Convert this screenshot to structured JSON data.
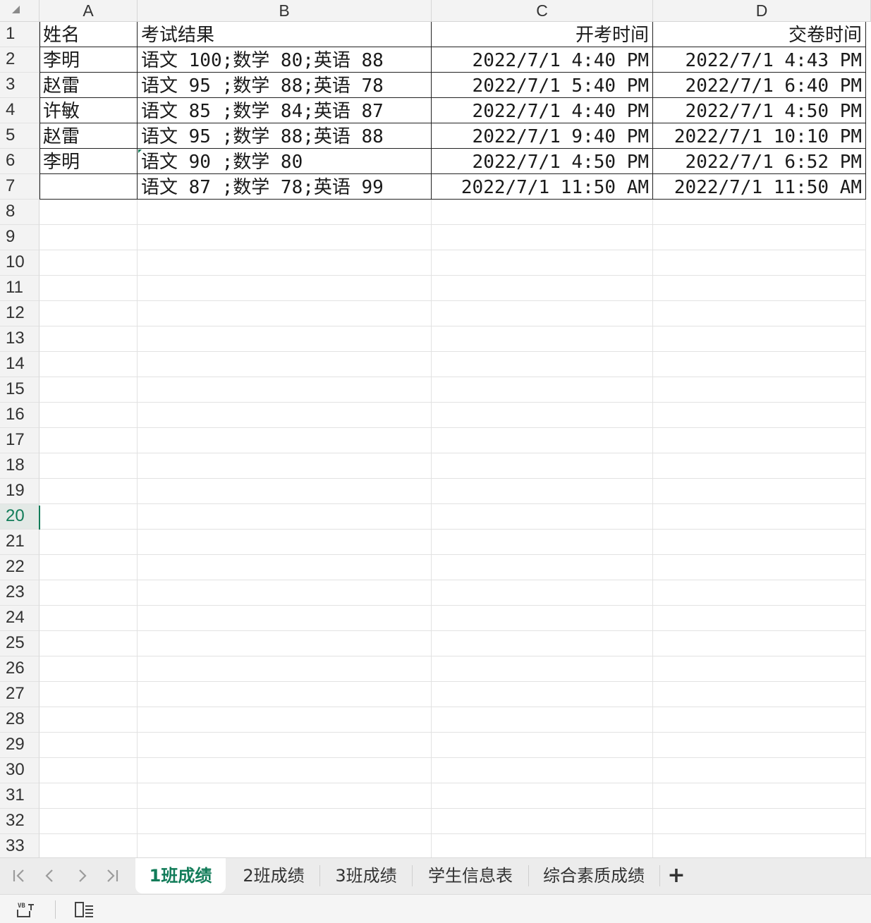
{
  "columns": [
    "A",
    "B",
    "C",
    "D"
  ],
  "rows": [
    {
      "num": "1",
      "cells": [
        "姓名",
        "考试结果",
        "开考时间",
        "交卷时间"
      ]
    },
    {
      "num": "2",
      "cells": [
        "李明",
        "语文 100;数学 80;英语 88",
        "2022/7/1 4:40 PM",
        "2022/7/1 4:43 PM"
      ]
    },
    {
      "num": "3",
      "cells": [
        "赵雷",
        "语文 95 ;数学 88;英语 78",
        "2022/7/1 5:40 PM",
        "2022/7/1 6:40 PM"
      ]
    },
    {
      "num": "4",
      "cells": [
        "许敏",
        "语文 85 ;数学 84;英语 87",
        "2022/7/1 4:40 PM",
        "2022/7/1 4:50 PM"
      ]
    },
    {
      "num": "5",
      "cells": [
        "赵雷",
        "语文 95 ;数学 88;英语 88",
        "2022/7/1 9:40 PM",
        "2022/7/1 10:10 PM"
      ]
    },
    {
      "num": "6",
      "cells": [
        "李明",
        "语文 90 ;数学 80",
        "2022/7/1 4:50 PM",
        "2022/7/1 6:52 PM"
      ]
    },
    {
      "num": "7",
      "cells": [
        "",
        "语文 87 ;数学 78;英语 99",
        "2022/7/1 11:50 AM",
        "2022/7/1 11:50 AM"
      ]
    }
  ],
  "empty_rows": [
    "8",
    "9",
    "10",
    "11",
    "12",
    "13",
    "14",
    "15",
    "16",
    "17",
    "18",
    "19",
    "20",
    "21",
    "22",
    "23",
    "24",
    "25",
    "26",
    "27",
    "28",
    "29",
    "30",
    "31",
    "32",
    "33"
  ],
  "active_row": "20",
  "sheet_tabs": [
    "1班成绩",
    "2班成绩",
    "3班成绩",
    "学生信息表",
    "综合素质成绩"
  ],
  "active_tab": "1班成绩",
  "nav_icons": [
    "first-sheet-icon",
    "prev-sheet-icon",
    "next-sheet-icon",
    "last-sheet-icon"
  ],
  "nav_glyphs": [
    "|<",
    "<",
    ">",
    ">|"
  ],
  "add_sheet_glyph": "+",
  "status_icons": [
    "macro-vb-icon",
    "sheet-outline-icon"
  ],
  "colors": {
    "accent": "#127c59",
    "header_bg": "#f3f3f3",
    "grid_line": "#e2e2e2",
    "border": "#222222"
  }
}
